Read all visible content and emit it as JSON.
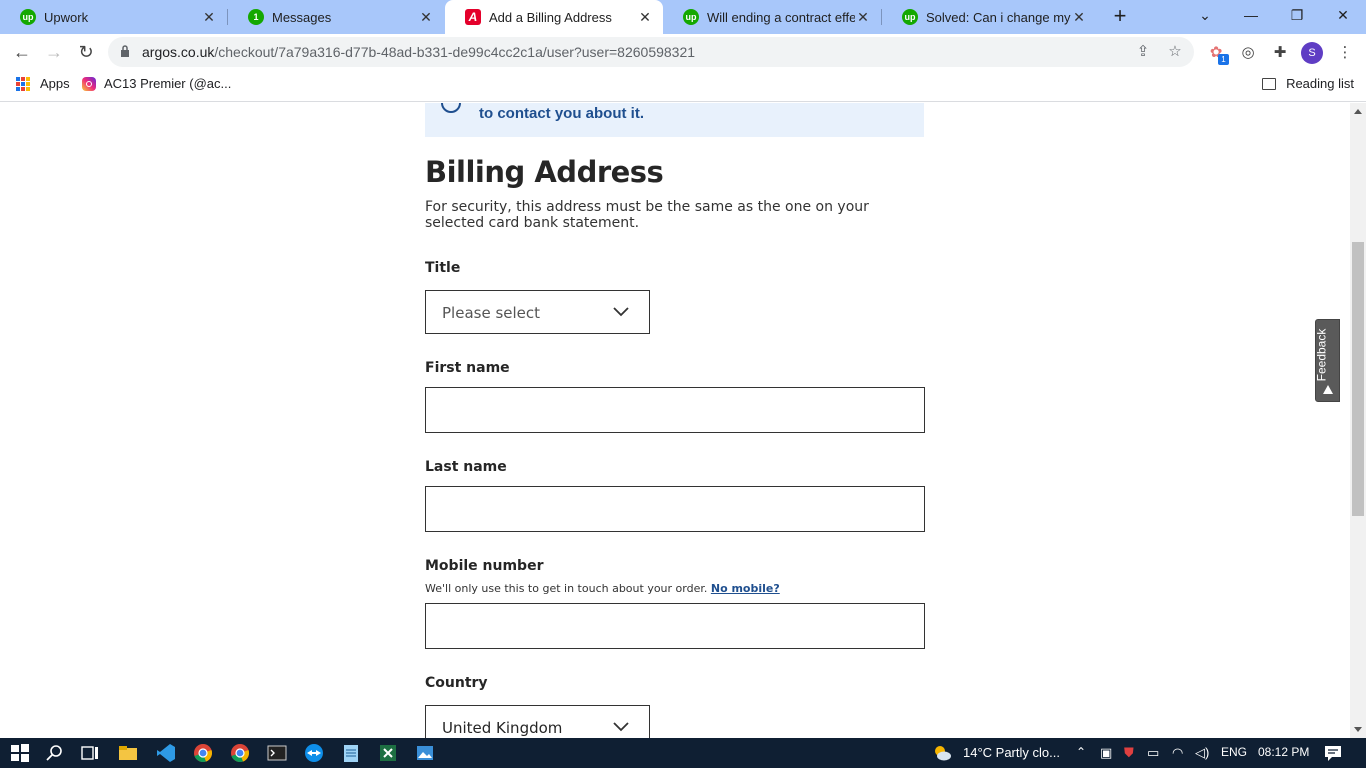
{
  "browser": {
    "tabs": [
      {
        "title": "Upwork",
        "icon": "upwork-icon"
      },
      {
        "title": "Messages",
        "icon": "upwork-messages-icon"
      },
      {
        "title": "Add a Billing Address",
        "icon": "argos-icon",
        "active": true
      },
      {
        "title": "Will ending a contract effect",
        "icon": "upwork-icon"
      },
      {
        "title": "Solved: Can i change my min",
        "icon": "upwork-icon"
      }
    ],
    "url_host": "argos.co.uk",
    "url_path": "/checkout/7a79a316-d77b-48ad-b331-de99c4cc2c1a/user?user=8260598321",
    "avatar_letter": "S",
    "extension_badge": "1",
    "bookmarks": {
      "apps": "Apps",
      "item1": "AC13 Premier (@ac...",
      "reading_list": "Reading list"
    }
  },
  "page": {
    "notice_text": "to contact you about it.",
    "heading": "Billing Address",
    "subtitle": "For security, this address must be the same as the one on your selected card bank statement.",
    "title_label": "Title",
    "title_select_value": "Please select",
    "first_name_label": "First name",
    "first_name_value": "",
    "last_name_label": "Last name",
    "last_name_value": "",
    "mobile_label": "Mobile number",
    "mobile_help": "We'll only use this to get in touch about your order.",
    "mobile_help_link": "No mobile?",
    "mobile_value": "",
    "country_label": "Country",
    "country_value": "United Kingdom",
    "feedback": "Feedback"
  },
  "taskbar": {
    "weather": "14°C  Partly clo...",
    "language": "ENG",
    "time": "08:12 PM"
  },
  "colors": {
    "tabstrip": "#a8c7fa",
    "notice_bg": "#e8f1fc",
    "link": "#1f4f8f",
    "taskbar": "#0f1f33"
  }
}
